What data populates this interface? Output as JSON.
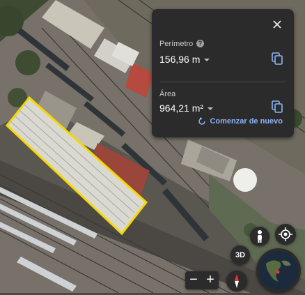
{
  "panel": {
    "perimeter_label": "Perímetro",
    "perimeter_value": "156,96 m",
    "area_label": "Área",
    "area_value": "964,21 m²",
    "restart_label": "Comenzar de nuevo"
  },
  "controls": {
    "btn_3d": "3D",
    "zoom_out": "−",
    "zoom_in": "+"
  },
  "colors": {
    "panel_bg": "#2b2b2b",
    "accent": "#8ab4f8",
    "measure_outline": "#f5d800"
  },
  "icons": [
    "close-icon",
    "help-icon",
    "copy-icon",
    "restart-icon",
    "pegman-icon",
    "locate-icon",
    "compass-icon",
    "globe-icon"
  ]
}
